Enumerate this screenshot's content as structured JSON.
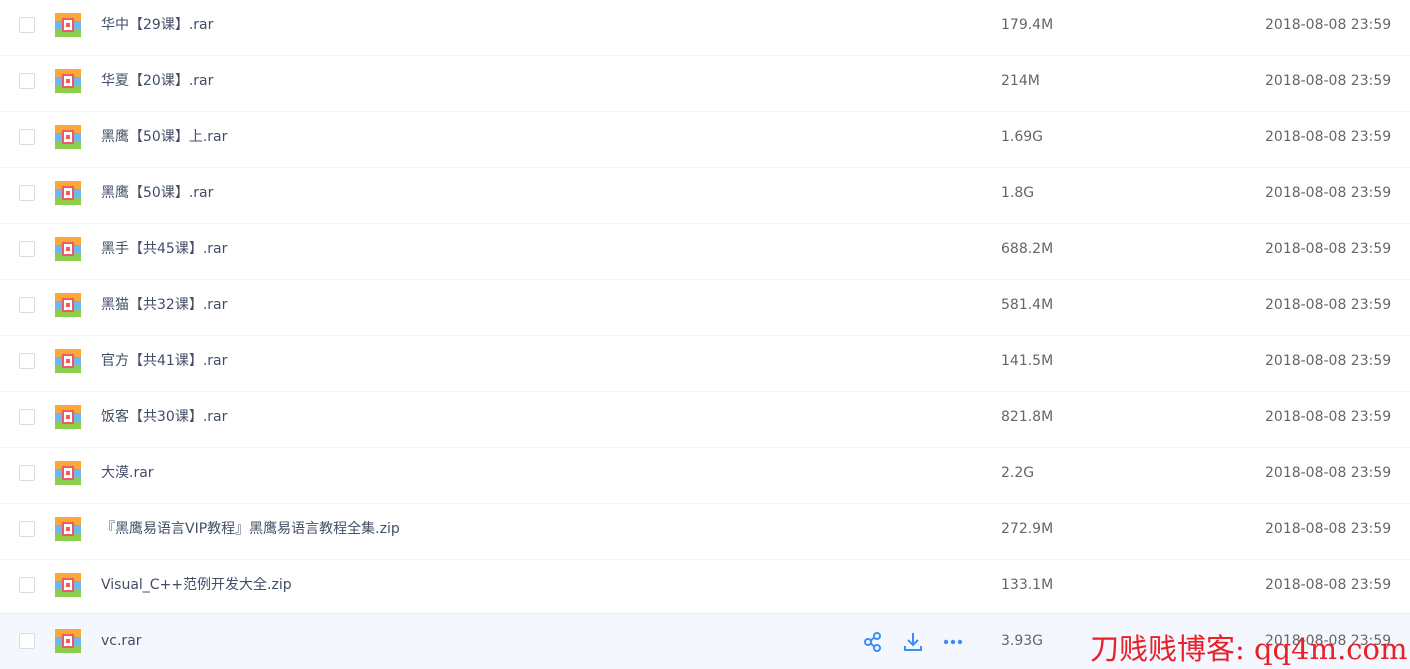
{
  "colors": {
    "hover_row_bg": "#f4f8fe",
    "accent_icon": "#3b8cff",
    "watermark": "#e8202a"
  },
  "files": [
    {
      "name": "华中【29课】.rar",
      "size": "179.4M",
      "date": "2018-08-08 23:59",
      "icon": "archive-icon"
    },
    {
      "name": "华夏【20课】.rar",
      "size": "214M",
      "date": "2018-08-08 23:59",
      "icon": "archive-icon"
    },
    {
      "name": "黑鹰【50课】上.rar",
      "size": "1.69G",
      "date": "2018-08-08 23:59",
      "icon": "archive-icon"
    },
    {
      "name": "黑鹰【50课】.rar",
      "size": "1.8G",
      "date": "2018-08-08 23:59",
      "icon": "archive-icon"
    },
    {
      "name": "黑手【共45课】.rar",
      "size": "688.2M",
      "date": "2018-08-08 23:59",
      "icon": "archive-icon"
    },
    {
      "name": "黑猫【共32课】.rar",
      "size": "581.4M",
      "date": "2018-08-08 23:59",
      "icon": "archive-icon"
    },
    {
      "name": "官方【共41课】.rar",
      "size": "141.5M",
      "date": "2018-08-08 23:59",
      "icon": "archive-icon"
    },
    {
      "name": "饭客【共30课】.rar",
      "size": "821.8M",
      "date": "2018-08-08 23:59",
      "icon": "archive-icon"
    },
    {
      "name": "大漠.rar",
      "size": "2.2G",
      "date": "2018-08-08 23:59",
      "icon": "archive-icon"
    },
    {
      "name": "『黑鹰易语言VIP教程』黑鹰易语言教程全集.zip",
      "size": "272.9M",
      "date": "2018-08-08 23:59",
      "icon": "archive-icon"
    },
    {
      "name": "Visual_C++范例开发大全.zip",
      "size": "133.1M",
      "date": "2018-08-08 23:59",
      "icon": "archive-icon"
    },
    {
      "name": "vc.rar",
      "size": "3.93G",
      "date": "2018-08-08 23:59",
      "icon": "archive-icon",
      "hovered": true
    }
  ],
  "row_actions": {
    "share": "share-icon",
    "download": "download-icon",
    "more": "more-icon"
  },
  "watermark": "刀贱贱博客: qq4m.com"
}
